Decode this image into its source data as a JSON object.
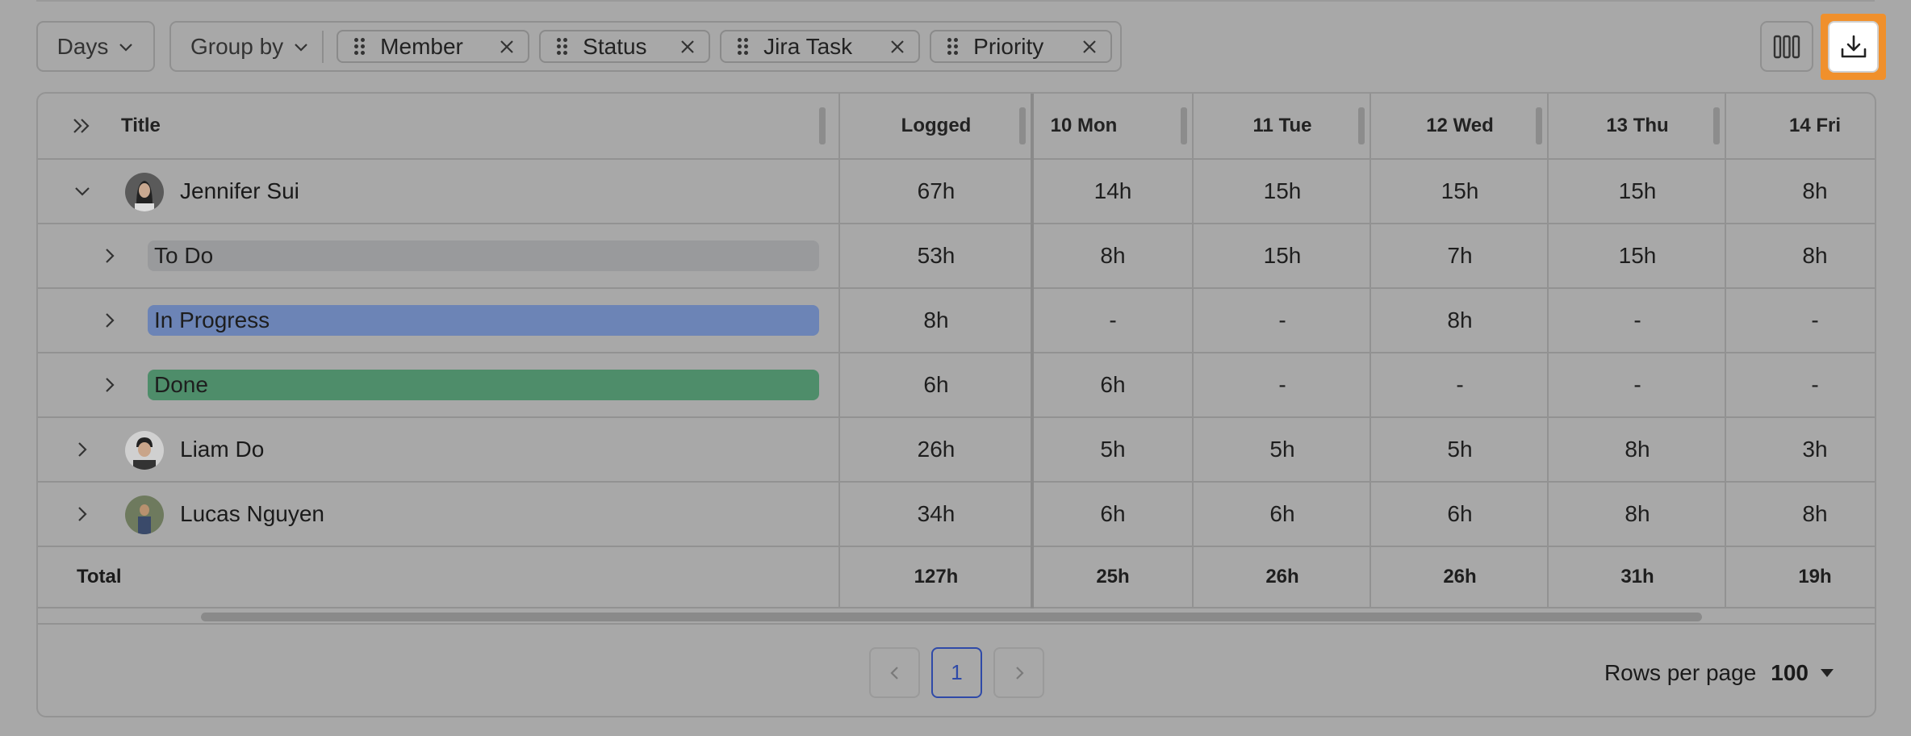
{
  "toolbar": {
    "range_label": "Days",
    "group_by_label": "Group by",
    "chips": [
      "Member",
      "Status",
      "Jira Task",
      "Priority"
    ]
  },
  "table": {
    "headers": {
      "title": "Title",
      "logged": "Logged",
      "days": [
        "10 Mon",
        "11 Tue",
        "12 Wed",
        "13 Thu",
        "14 Fri"
      ]
    },
    "rows": [
      {
        "label": "Jennifer Sui",
        "logged": "67h",
        "days": [
          "14h",
          "15h",
          "15h",
          "15h",
          "8h"
        ]
      },
      {
        "label": "To Do",
        "logged": "53h",
        "days": [
          "8h",
          "15h",
          "7h",
          "15h",
          "8h"
        ]
      },
      {
        "label": "In Progress",
        "logged": "8h",
        "days": [
          "-",
          "-",
          "8h",
          "-",
          "-"
        ]
      },
      {
        "label": "Done",
        "logged": "6h",
        "days": [
          "6h",
          "-",
          "-",
          "-",
          "-"
        ]
      },
      {
        "label": "Liam Do",
        "logged": "26h",
        "days": [
          "5h",
          "5h",
          "5h",
          "8h",
          "3h"
        ]
      },
      {
        "label": "Lucas Nguyen",
        "logged": "34h",
        "days": [
          "6h",
          "6h",
          "6h",
          "8h",
          "8h"
        ]
      }
    ],
    "total": {
      "label": "Total",
      "logged": "127h",
      "days": [
        "25h",
        "26h",
        "26h",
        "31h",
        "19h"
      ]
    }
  },
  "status_colors": {
    "todo": "#999a9c",
    "in_progress": "#6c84b6",
    "done": "#4e8d6a"
  },
  "pagination": {
    "current_page": "1"
  },
  "rows_per_page": {
    "label": "Rows per page",
    "value": "100"
  }
}
